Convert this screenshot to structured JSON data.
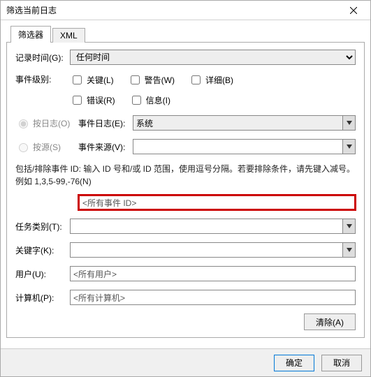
{
  "title": "筛选当前日志",
  "tabs": {
    "filter": "筛选器",
    "xml": "XML"
  },
  "labels": {
    "logtime": "记录时间(G):",
    "level": "事件级别:",
    "bylog": "按日志(O)",
    "bysource": "按源(S)",
    "eventlog": "事件日志(E):",
    "eventsource": "事件来源(V):",
    "task": "任务类别(T):",
    "keyword": "关键字(K):",
    "user": "用户(U):",
    "computer": "计算机(P):"
  },
  "values": {
    "logtime": "任何时间",
    "eventlog": "系统",
    "eventsource": "",
    "eventid": "<所有事件 ID>",
    "task": "",
    "keyword": "",
    "user": "<所有用户>",
    "computer": "<所有计算机>"
  },
  "checkboxes": {
    "critical": "关键(L)",
    "warning": "警告(W)",
    "verbose": "详细(B)",
    "error": "错误(R)",
    "info": "信息(I)"
  },
  "helptext": "包括/排除事件 ID: 输入 ID 号和/或 ID 范围，使用逗号分隔。若要排除条件，请先键入减号。例如 1,3,5-99,-76(N)",
  "buttons": {
    "clear": "清除(A)",
    "ok": "确定",
    "cancel": "取消"
  }
}
